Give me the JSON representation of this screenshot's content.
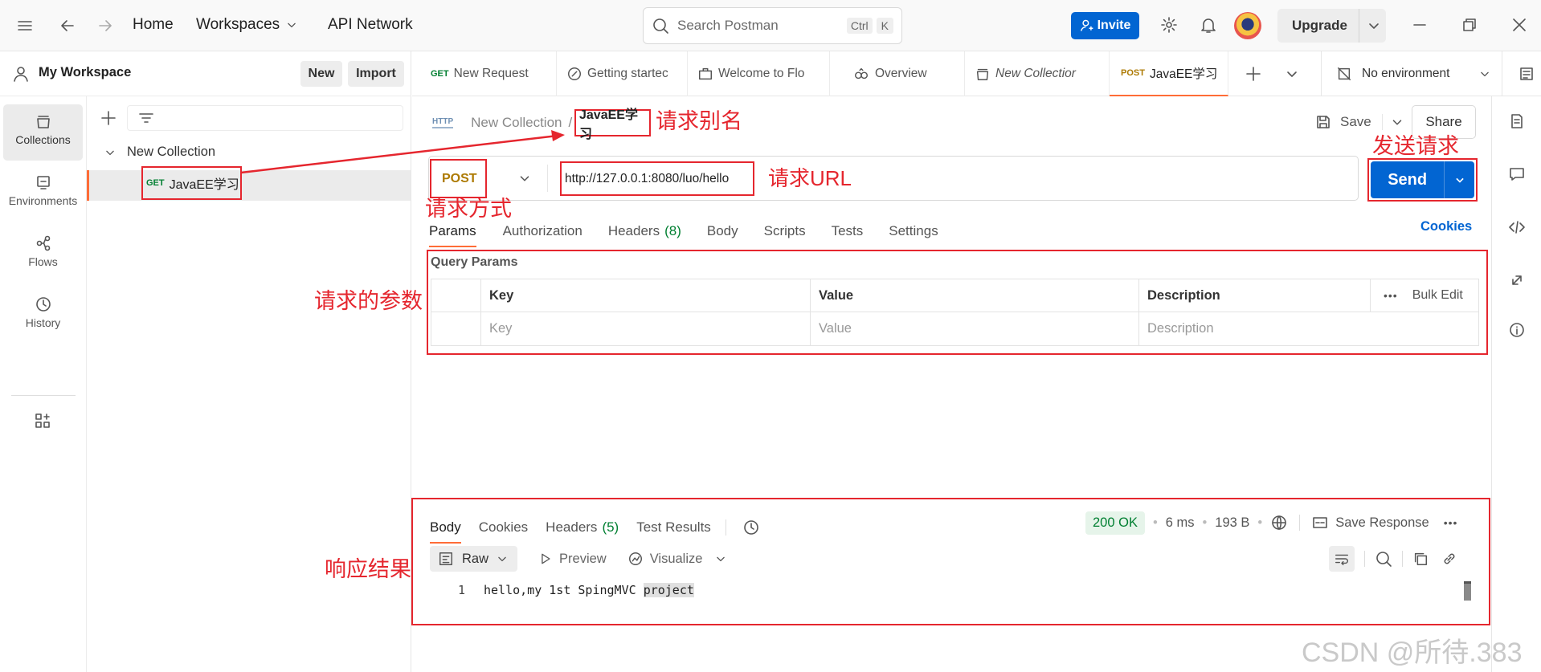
{
  "topbar": {
    "home": "Home",
    "workspaces": "Workspaces",
    "api_network": "API Network",
    "search_placeholder": "Search Postman",
    "kbd_ctrl": "Ctrl",
    "kbd_k": "K",
    "invite": "Invite",
    "upgrade": "Upgrade"
  },
  "sidebar": {
    "workspace_name": "My Workspace",
    "new_btn": "New",
    "import_btn": "Import",
    "nav": [
      {
        "label": "Collections",
        "icon": "collections-icon"
      },
      {
        "label": "Environments",
        "icon": "environments-icon"
      },
      {
        "label": "Flows",
        "icon": "flows-icon"
      },
      {
        "label": "History",
        "icon": "history-icon"
      }
    ],
    "collection_name": "New Collection",
    "request_method": "GET",
    "request_name": "JavaEE学习"
  },
  "tabs": [
    {
      "method": "GET",
      "label": "New Request"
    },
    {
      "label": "Getting startec"
    },
    {
      "label": "Welcome to Flo"
    },
    {
      "label": "Overview"
    },
    {
      "label": "New Collectior"
    },
    {
      "method": "POST",
      "label": "JavaEE学习"
    }
  ],
  "environment": "No environment",
  "request": {
    "breadcrumb_parent": "New Collection",
    "breadcrumb_sep": "/",
    "name": "JavaEE学习",
    "save": "Save",
    "share": "Share",
    "method": "POST",
    "url": "http://127.0.0.1:8080/luo/hello",
    "send": "Send"
  },
  "req_tabs": {
    "params": "Params",
    "authorization": "Authorization",
    "headers": "Headers",
    "headers_count": "(8)",
    "body": "Body",
    "scripts": "Scripts",
    "tests": "Tests",
    "settings": "Settings",
    "cookies": "Cookies"
  },
  "params": {
    "title": "Query Params",
    "col_key": "Key",
    "col_value": "Value",
    "col_description": "Description",
    "bulk_edit": "Bulk Edit",
    "ph_key": "Key",
    "ph_value": "Value",
    "ph_description": "Description"
  },
  "response": {
    "tabs": {
      "body": "Body",
      "cookies": "Cookies",
      "headers": "Headers",
      "headers_count": "(5)",
      "tests": "Test Results"
    },
    "status": "200 OK",
    "time": "6 ms",
    "size": "193 B",
    "save_response": "Save Response",
    "format": "Raw",
    "preview": "Preview",
    "visualize": "Visualize",
    "line_no": "1",
    "body_text": "hello,my 1st SpingMVC ",
    "body_selected": "project"
  },
  "annotations": {
    "alias": "请求别名",
    "send": "发送请求",
    "url": "请求URL",
    "method": "请求方式",
    "params": "请求的参数",
    "result": "响应结果"
  },
  "watermark": "CSDN @所待.383",
  "colors": {
    "accent_blue": "#0265d2",
    "annotation_red": "#e5262e",
    "status_green": "#007f31",
    "post_method": "#ad7a03",
    "get_method": "#007f31",
    "active_tab_orange": "#ff6c37"
  }
}
